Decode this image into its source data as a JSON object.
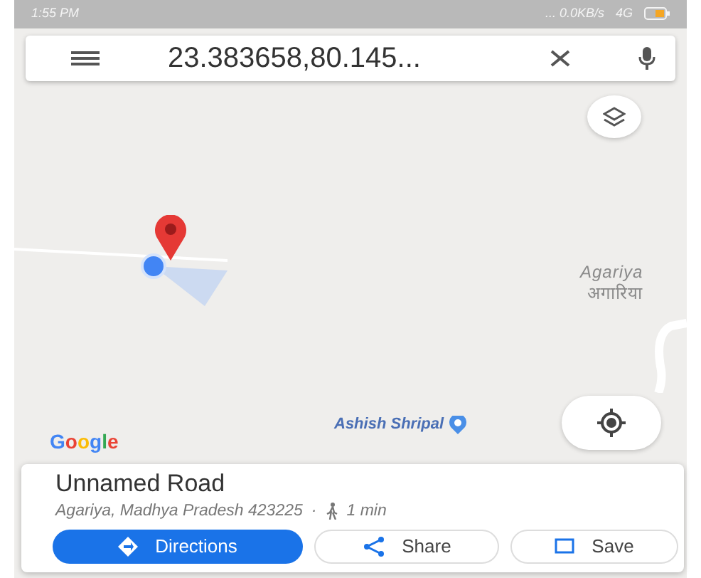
{
  "status_bar": {
    "time": "1:55 PM",
    "indicators": "... 0.0KB/s",
    "network": "4G"
  },
  "search": {
    "value": "23.383658,80.145..."
  },
  "map": {
    "labels": [
      {
        "kind": "place",
        "text": "Agariya",
        "subtext": "अगारिया"
      },
      {
        "kind": "poi",
        "text": "Ashish Shripal"
      }
    ],
    "logo": "Google"
  },
  "place": {
    "title": "Unnamed Road",
    "address": "Agariya, Madhya Pradesh 423225",
    "separator": "·",
    "travel_time": "1 min"
  },
  "actions": [
    {
      "label": "Directions",
      "kind": "primary"
    },
    {
      "label": "Share",
      "kind": "share"
    },
    {
      "label": "Save",
      "kind": "save"
    }
  ]
}
